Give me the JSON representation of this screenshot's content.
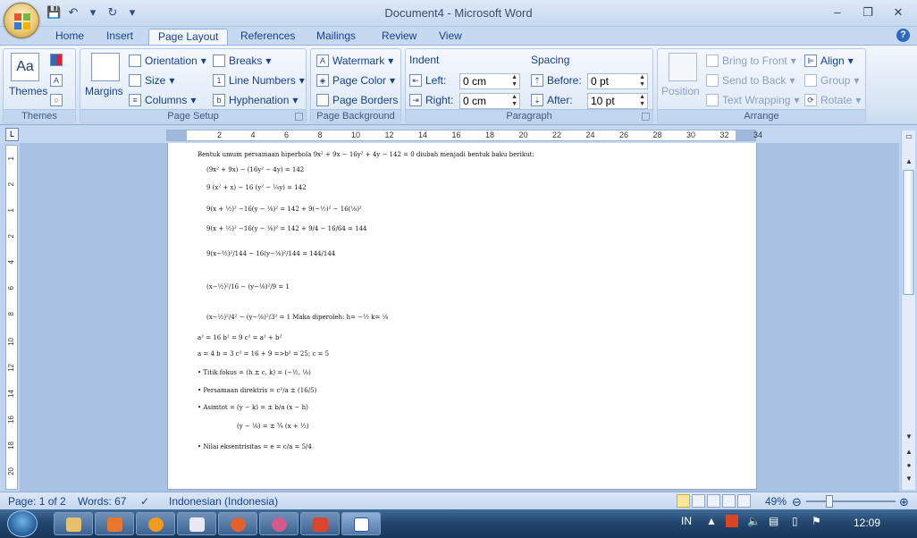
{
  "window": {
    "title": "Document4 - Microsoft Word",
    "controls": [
      "–",
      "❐",
      "✕"
    ]
  },
  "qat": [
    "💾",
    "↶",
    "▾",
    "↻",
    "▾"
  ],
  "tabs": [
    "Home",
    "Insert",
    "Page Layout",
    "References",
    "Mailings",
    "Review",
    "View"
  ],
  "active_tab": "Page Layout",
  "ribbon": {
    "themes": {
      "label": "Themes",
      "group": "Themes"
    },
    "page_setup": {
      "group": "Page Setup",
      "margins": "Margins",
      "orientation": "Orientation",
      "size": "Size",
      "columns": "Columns",
      "breaks": "Breaks",
      "line_numbers": "Line Numbers",
      "hyphenation": "Hyphenation"
    },
    "page_background": {
      "group": "Page Background",
      "watermark": "Watermark",
      "page_color": "Page Color",
      "page_borders": "Page Borders"
    },
    "paragraph": {
      "group": "Paragraph",
      "indent": "Indent",
      "left_label": "Left:",
      "left_value": "0 cm",
      "right_label": "Right:",
      "right_value": "0 cm",
      "spacing": "Spacing",
      "before_label": "Before:",
      "before_value": "0 pt",
      "after_label": "After:",
      "after_value": "10 pt"
    },
    "arrange": {
      "group": "Arrange",
      "position": "Position",
      "bring_to_front": "Bring to Front",
      "send_to_back": "Send to Back",
      "text_wrapping": "Text Wrapping",
      "align": "Align",
      "group_btn": "Group",
      "rotate": "Rotate"
    }
  },
  "ruler": {
    "ticks": [
      "2",
      "4",
      "6",
      "8",
      "10",
      "12",
      "14",
      "16",
      "18",
      "20",
      "22",
      "24",
      "26",
      "28",
      "30",
      "32",
      "34"
    ],
    "vticks": [
      "1",
      "2",
      "1",
      "2",
      "4",
      "6",
      "8",
      "10",
      "12",
      "14",
      "16",
      "18",
      "20"
    ]
  },
  "document": {
    "lines": [
      "Bentuk umum persamaan hiperbola 9x² + 9x − 16y² + 4y − 142 = 0 diubah menjadi     bentuk baku berikut:",
      "(9x² + 9x) − (16y² − 4y) = 142",
      "9 (x² + x) − 16 (y² − ¼y) = 142",
      "9(x + ½)² −16(y − ⅛)²      = 142 + 9(−½)² − 16(⅛)²",
      "9(x + ½)² −16(y − ⅛)²      = 142 + 9/4 − 16/64 = 144",
      "9(x−½)²/144 − 16(y−⅛)²/144      = 144/144",
      "(x−½)²/16 − (y−⅛)²/9           = 1",
      "(x−½)²/4² − (y−⅛)²/3²           = 1   Maka diperoleh: h= −½  k= ⅛",
      "a² = 16              b² = 9          c² = a² + b²",
      "a   = 4               b   = 3          c² = 16 + 9  =>b² = 25;  c = 5",
      "•  Titik fokus = (h ± c, k) = (−½, ⅛)",
      "•  Persamaan direktris = c²/a ± (16/5)",
      "•  Asimtot = (y − k) = ± b/a (x − h)",
      "(y − ⅛) = ± ¾ (x + ½)",
      "• Nilai eksentrisitas = e = c/a = 5/4"
    ]
  },
  "status": {
    "page": "Page: 1 of 2",
    "words": "Words: 67",
    "language": "Indonesian (Indonesia)",
    "zoom": "49%",
    "zoom_value": 0.49
  },
  "taskbar": {
    "lang": "IN",
    "time": "12:09"
  }
}
